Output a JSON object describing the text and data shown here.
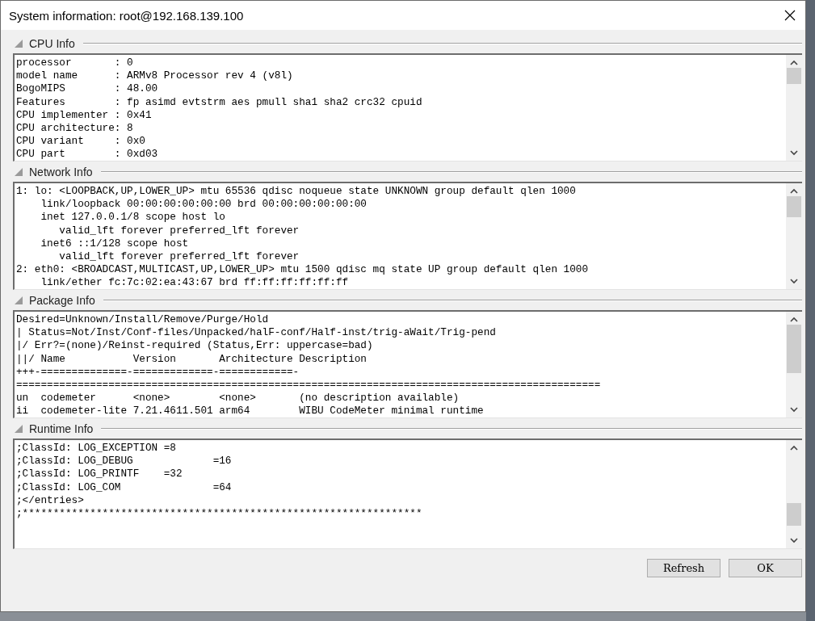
{
  "window": {
    "title": "System information: root@192.168.139.100"
  },
  "sections": [
    {
      "title": "CPU Info",
      "lines": [
        "processor       : 0",
        "model name      : ARMv8 Processor rev 4 (v8l)",
        "BogoMIPS        : 48.00",
        "Features        : fp asimd evtstrm aes pmull sha1 sha2 crc32 cpuid",
        "CPU implementer : 0x41",
        "CPU architecture: 8",
        "CPU variant     : 0x0",
        "CPU part        : 0xd03"
      ]
    },
    {
      "title": "Network Info",
      "lines": [
        "1: lo: <LOOPBACK,UP,LOWER_UP> mtu 65536 qdisc noqueue state UNKNOWN group default qlen 1000",
        "    link/loopback 00:00:00:00:00:00 brd 00:00:00:00:00:00",
        "    inet 127.0.0.1/8 scope host lo",
        "       valid_lft forever preferred_lft forever",
        "    inet6 ::1/128 scope host",
        "       valid_lft forever preferred_lft forever",
        "2: eth0: <BROADCAST,MULTICAST,UP,LOWER_UP> mtu 1500 qdisc mq state UP group default qlen 1000",
        "    link/ether fc:7c:02:ea:43:67 brd ff:ff:ff:ff:ff:ff"
      ]
    },
    {
      "title": "Package Info",
      "lines": [
        "Desired=Unknown/Install/Remove/Purge/Hold",
        "| Status=Not/Inst/Conf-files/Unpacked/halF-conf/Half-inst/trig-aWait/Trig-pend",
        "|/ Err?=(none)/Reinst-required (Status,Err: uppercase=bad)",
        "||/ Name           Version       Architecture Description",
        "+++-==============-=============-============-",
        "===============================================================================================",
        "un  codemeter      <none>        <none>       (no description available)",
        "ii  codemeter-lite 7.21.4611.501 arm64        WIBU CodeMeter minimal runtime"
      ]
    },
    {
      "title": "Runtime Info",
      "lines": [
        ";ClassId: LOG_EXCEPTION =8",
        ";ClassId: LOG_DEBUG             =16",
        ";ClassId: LOG_PRINTF    =32",
        ";ClassId: LOG_COM               =64",
        ";</entries>",
        ";*****************************************************************"
      ]
    }
  ],
  "buttons": [
    "Refresh",
    "OK"
  ]
}
